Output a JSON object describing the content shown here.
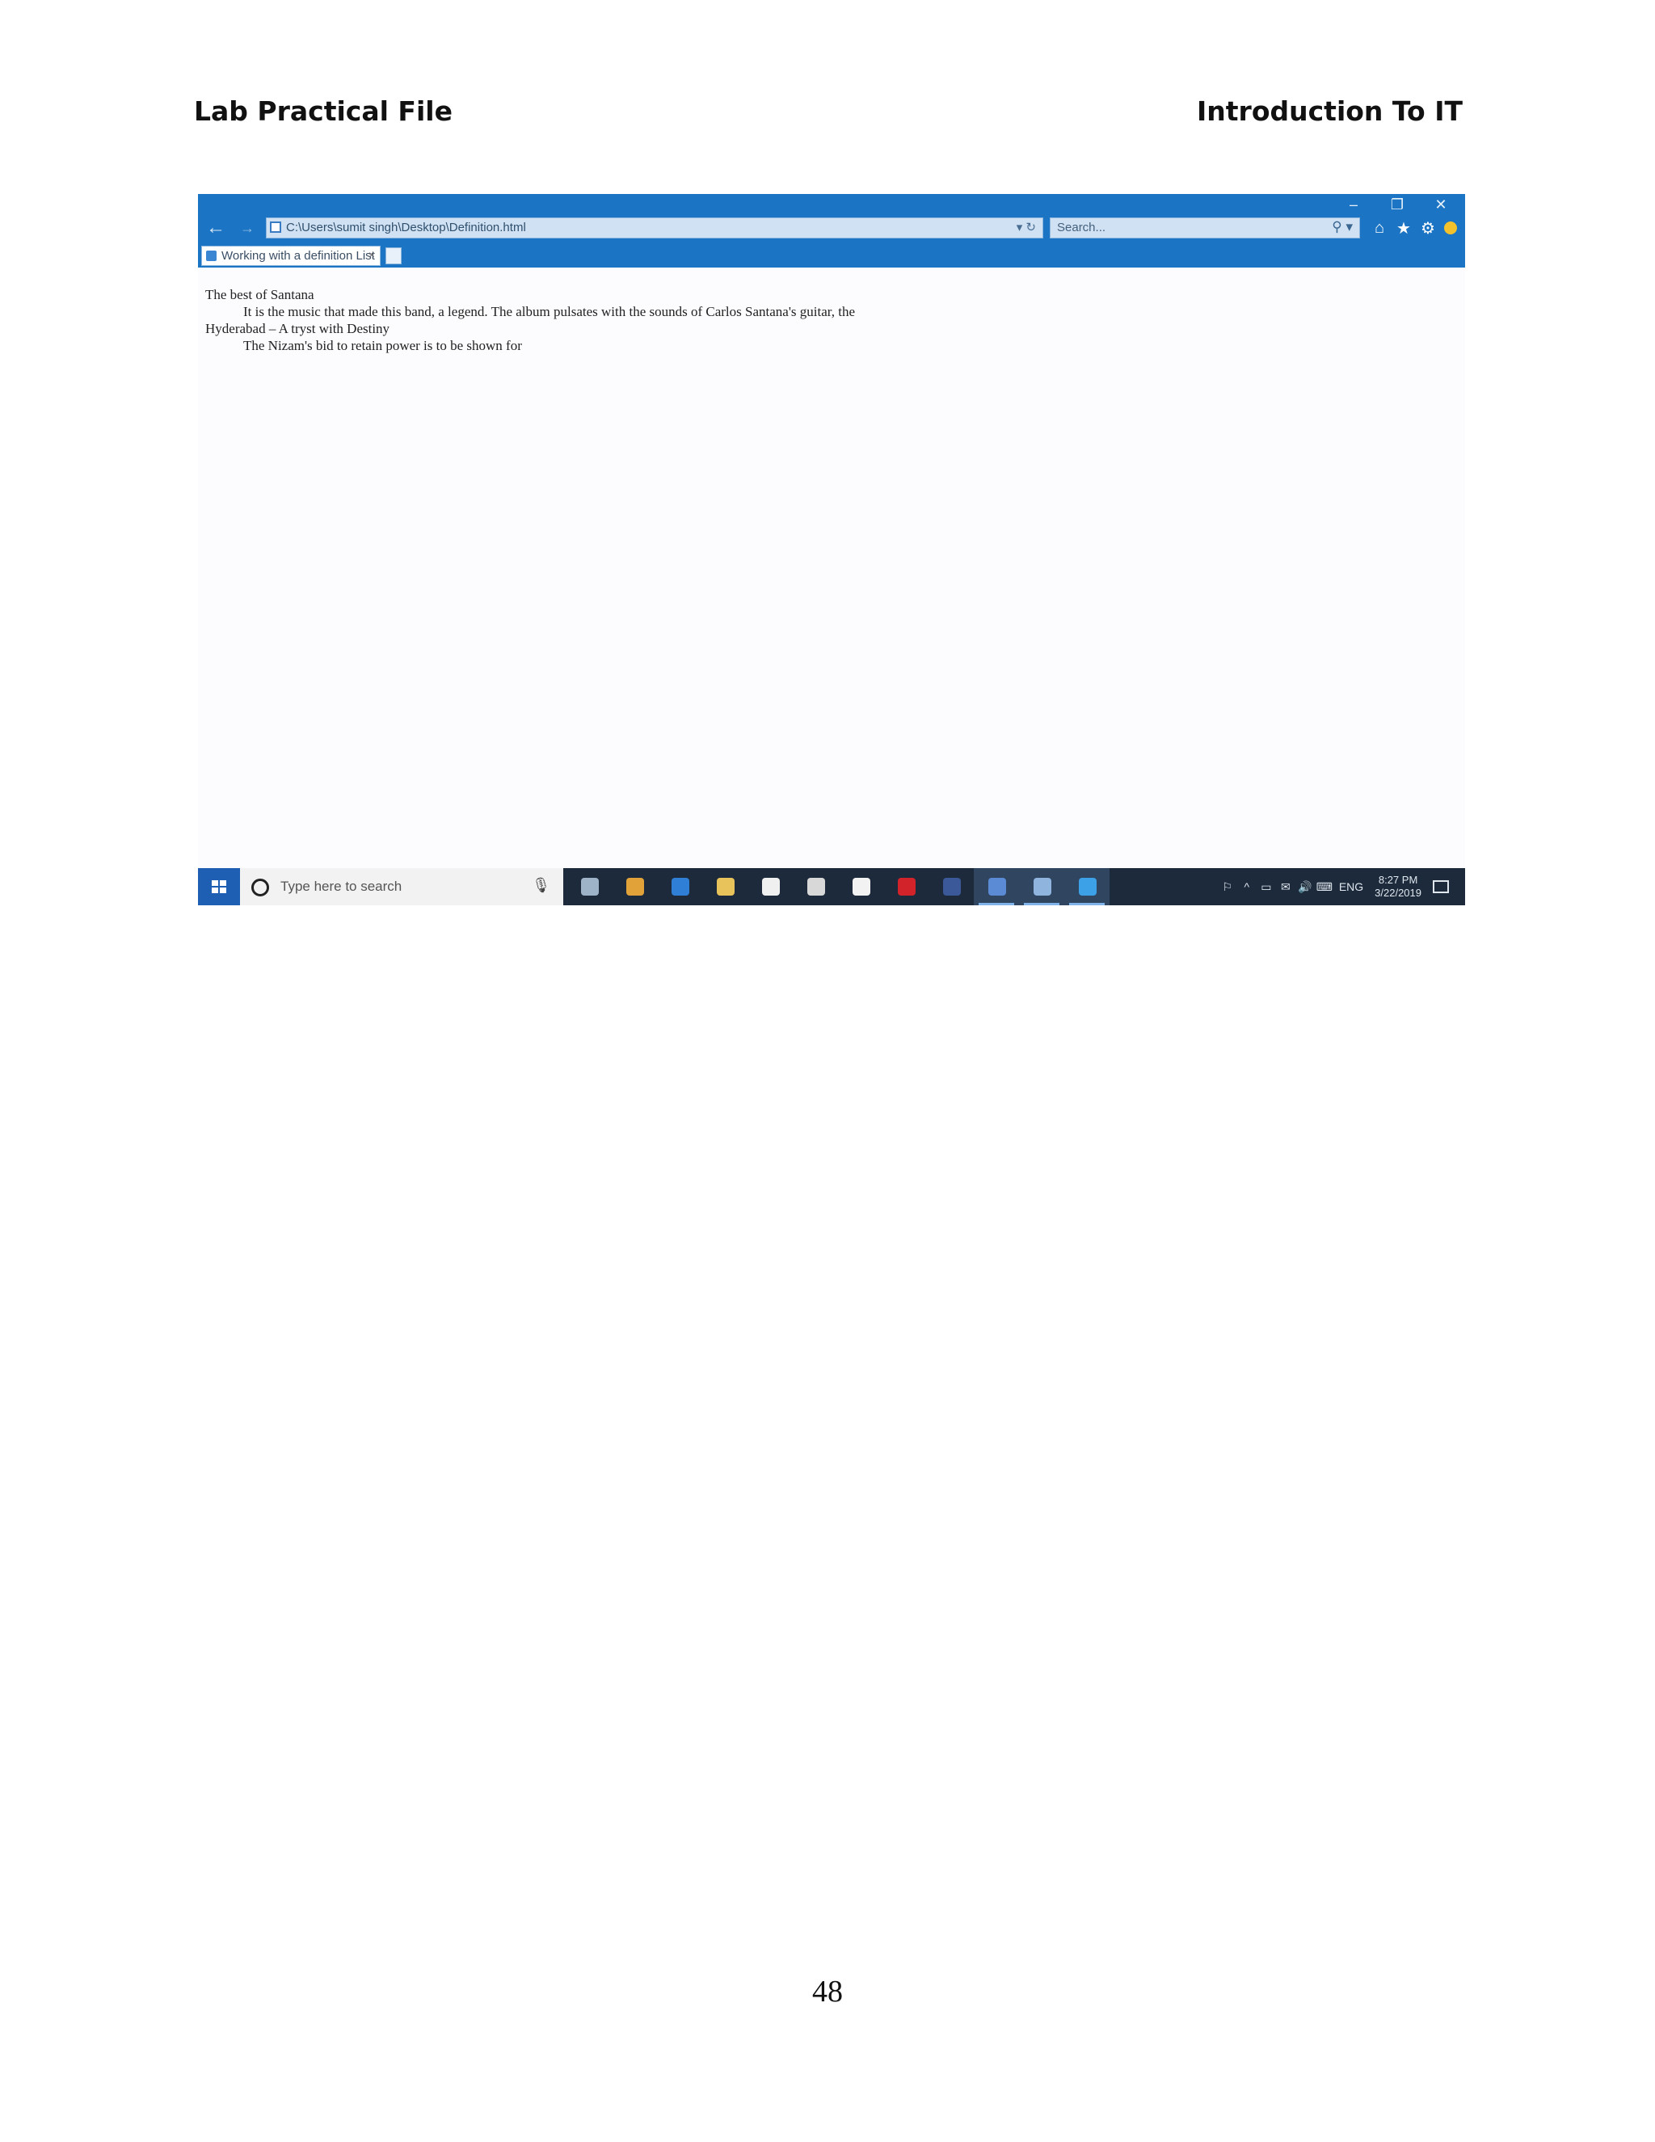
{
  "header": {
    "left": "Lab Practical File",
    "right": "Introduction To IT"
  },
  "browser": {
    "window_controls": {
      "minimize": "–",
      "restore": "❐",
      "close": "✕"
    },
    "address": "C:\\Users\\sumit singh\\Desktop\\Definition.html",
    "address_controls": "▾ ↻",
    "search_placeholder": "Search...",
    "search_icon": "⚲ ▾",
    "tools": {
      "home": "⌂",
      "favorites": "★",
      "settings": "⚙"
    },
    "tab": {
      "title": "Working with a definition List",
      "close": "×"
    },
    "nav": {
      "back": "←",
      "forward": "→"
    }
  },
  "definition_list": [
    {
      "term": "The best of Santana",
      "definition": "It is the music that made this band, a legend. The album pulsates with the sounds of Carlos Santana's guitar, the"
    },
    {
      "term": "Hyderabad – A tryst with Destiny",
      "definition": "The Nizam's bid to retain power is to be shown for"
    }
  ],
  "taskbar": {
    "search_placeholder": "Type here to search",
    "mic_icon": "🎙",
    "apps": [
      {
        "name": "task-view",
        "color": "#9fb3c8"
      },
      {
        "name": "chrome",
        "color": "#e2a23a"
      },
      {
        "name": "edge",
        "color": "#2f7fd6"
      },
      {
        "name": "file-explorer",
        "color": "#e8c25a"
      },
      {
        "name": "store",
        "color": "#f0f0f0"
      },
      {
        "name": "groove",
        "color": "#d8d8d8"
      },
      {
        "name": "mail",
        "color": "#f2f2f2"
      },
      {
        "name": "opera",
        "color": "#d3232a"
      },
      {
        "name": "facebook",
        "color": "#3b5998"
      },
      {
        "name": "word",
        "color": "#5c8bd6"
      },
      {
        "name": "notes",
        "color": "#8fb4de"
      },
      {
        "name": "internet-explorer",
        "color": "#3da1e8"
      }
    ],
    "tray": {
      "icons": [
        "⚐",
        "^",
        "▭",
        "✉",
        "🔊",
        "⌨"
      ],
      "lang": "ENG",
      "time": "8:27 PM",
      "date": "3/22/2019"
    }
  },
  "footer": {
    "page_number": "48"
  }
}
